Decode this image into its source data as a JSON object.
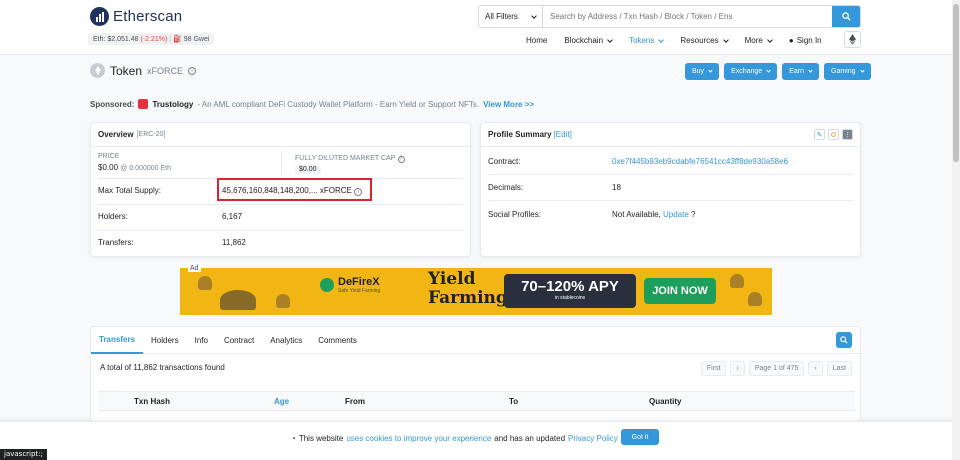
{
  "header": {
    "brand": "Etherscan",
    "eth_price": "Eth: $2,051.48",
    "eth_change": "(-2.21%)",
    "gas": "98 Gwei",
    "search_filter": "All Filters",
    "search_placeholder": "Search by Address / Txn Hash / Block / Token / Ens",
    "nav": [
      {
        "label": "Home"
      },
      {
        "label": "Blockchain"
      },
      {
        "label": "Tokens"
      },
      {
        "label": "Resources"
      },
      {
        "label": "More"
      },
      {
        "label": "Sign In"
      }
    ]
  },
  "token": {
    "title": "Token",
    "symbol": "xFORCE",
    "actions": [
      "Buy",
      "Exchange",
      "Earn",
      "Gaming"
    ]
  },
  "sponsored": {
    "label": "Sponsored:",
    "name": "Trustology",
    "text": "- An AML compliant DeFi Custody Wallet Platform - Earn Yield or Support NFTs.",
    "link": "View More >>"
  },
  "overview": {
    "title": "Overview",
    "standard": "[ERC-20]",
    "price_label": "PRICE",
    "price_value": "$0.00",
    "price_eth": "@ 0.000000 Eth",
    "fdmc_label": "FULLY DILUTED MARKET CAP",
    "fdmc_value": "$0.00",
    "max_supply_label": "Max Total Supply:",
    "max_supply_value": "45,676,160,848,148,200,...",
    "max_supply_symbol": "xFORCE",
    "holders_label": "Holders:",
    "holders_value": "6,167",
    "transfers_label": "Transfers:",
    "transfers_value": "11,862"
  },
  "profile": {
    "title": "Profile Summary",
    "edit": "[Edit]",
    "contract_label": "Contract:",
    "contract_value": "0xe7f445b93eb9cdabfe76541cc43ff8de930a58e6",
    "decimals_label": "Decimals:",
    "decimals_value": "18",
    "social_label": "Social Profiles:",
    "social_value": "Not Available,",
    "social_link": "Update",
    "social_suffix": "?"
  },
  "ad": {
    "tag": "Ad",
    "brand": "DeFireX",
    "brand_sub": "Safe Yield Farming",
    "headline_1": "Yield",
    "headline_2": "Farming",
    "apy": "70–120% APY",
    "apy_sub": "in stablecoins",
    "cta": "JOIN NOW"
  },
  "tabs": {
    "items": [
      "Transfers",
      "Holders",
      "Info",
      "Contract",
      "Analytics",
      "Comments"
    ],
    "count_text": "A total of 11,862 transactions found",
    "pager": {
      "first": "First",
      "prev": "‹",
      "page": "Page 1 of 475",
      "next": "›",
      "last": "Last"
    },
    "columns": [
      "Txn Hash",
      "Age",
      "From",
      "To",
      "Quantity"
    ]
  },
  "cookie": {
    "text_1": "This website",
    "link_1": "uses cookies to improve your experience",
    "text_2": "and has an updated",
    "link_2": "Privacy Policy",
    "text_3": ".",
    "button": "Got it"
  },
  "statusbar": "javascript:;"
}
